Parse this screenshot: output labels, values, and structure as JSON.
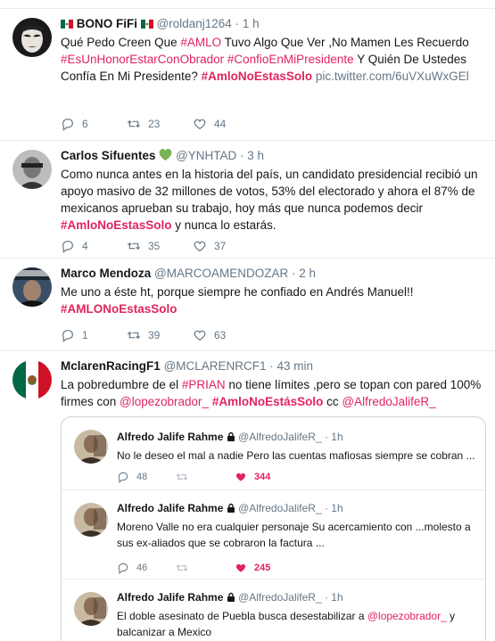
{
  "tweets": [
    {
      "name": "BONO FiFi",
      "handle": "@roldanj1264",
      "time": "· 1 h",
      "text_parts": [
        {
          "t": "Qué Pedo Creen Que ",
          "k": "plain"
        },
        {
          "t": "#AMLO",
          "k": "tag-light"
        },
        {
          "t": " Tuvo Algo Que Ver ,No Mamen Les Recuerdo ",
          "k": "plain"
        },
        {
          "t": "#EsUnHonorEstarConObrador",
          "k": "tag-light"
        },
        {
          "t": "  ",
          "k": "plain"
        },
        {
          "t": "#ConfioEnMiPresidente",
          "k": "tag-light"
        },
        {
          "t": " Y Quién De Ustedes Confía En Mi Presidente? ",
          "k": "plain"
        },
        {
          "t": "#AmloNoEstasSolo",
          "k": "tag"
        },
        {
          "t": " ",
          "k": "plain"
        },
        {
          "t": "pic.twitter.com/6uVXuWxGEl",
          "k": "link"
        }
      ],
      "replies": "6",
      "retweets": "23",
      "likes": "44"
    },
    {
      "name": "Carlos Sifuentes",
      "handle": "@YNHTAD",
      "time": "· 3 h",
      "text_parts": [
        {
          "t": "Como nunca antes en la historia del país, un candidato presidencial recibió un apoyo masivo de 32 millones de votos, 53% del electorado y ahora el 87% de mexicanos aprueban su trabajo, hoy más que nunca podemos decir ",
          "k": "plain"
        },
        {
          "t": "#AmloNoEstasSolo",
          "k": "tag"
        },
        {
          "t": " y nunca lo estarás.",
          "k": "plain"
        }
      ],
      "replies": "4",
      "retweets": "35",
      "likes": "37"
    },
    {
      "name": "Marco Mendoza",
      "handle": "@MARCOAMENDOZAR",
      "time": "· 2 h",
      "text_parts": [
        {
          "t": "Me uno a éste ht, porque siempre he confiado en Andrés Manuel!! ",
          "k": "plain"
        },
        {
          "t": "#AMLONoEstasSolo",
          "k": "tag"
        }
      ],
      "replies": "1",
      "retweets": "39",
      "likes": "63"
    },
    {
      "name": "MclarenRacingF1",
      "handle": "@MCLARENRCF1",
      "time": "· 43 min",
      "text_parts": [
        {
          "t": "La pobredumbre de el ",
          "k": "plain"
        },
        {
          "t": "#PRIAN",
          "k": "tag-light"
        },
        {
          "t": " no tiene límites ,pero se topan con pared 100% firmes con ",
          "k": "plain"
        },
        {
          "t": "@lopezobrador_",
          "k": "mention"
        },
        {
          "t": " ",
          "k": "plain"
        },
        {
          "t": "#AmloNoEstásSolo",
          "k": "tag"
        },
        {
          "t": " cc ",
          "k": "plain"
        },
        {
          "t": "@AlfredoJalifeR_",
          "k": "mention"
        }
      ]
    }
  ],
  "quoted": [
    {
      "name": "Alfredo Jalife Rahme",
      "handle": "@AlfredoJalifeR_",
      "time": "· 1h",
      "text_parts": [
        {
          "t": "No le deseo el mal a nadie Pero las cuentas mafiosas siempre se cobran ...",
          "k": "plain"
        }
      ],
      "replies": "48",
      "likes": "344"
    },
    {
      "name": "Alfredo Jalife Rahme",
      "handle": "@AlfredoJalifeR_",
      "time": "· 1h",
      "text_parts": [
        {
          "t": "Moreno Valle no era cualquier personaje Su acercamiento con ...molesto a sus ex-aliados que se cobraron la factura ...",
          "k": "plain"
        }
      ],
      "replies": "46",
      "likes": "245"
    },
    {
      "name": "Alfredo Jalife Rahme",
      "handle": "@AlfredoJalifeR_",
      "time": "· 1h",
      "text_parts": [
        {
          "t": "El doble asesinato de Puebla busca desestabilizar a ",
          "k": "plain"
        },
        {
          "t": "@lopezobrador_",
          "k": "mention"
        },
        {
          "t": "  y balcanizar a Mexico",
          "k": "plain"
        }
      ]
    }
  ],
  "colors": {
    "accent": "#e0245e",
    "muted": "#657786",
    "divider": "#e6ecf0",
    "heart_green": "#77b255"
  }
}
